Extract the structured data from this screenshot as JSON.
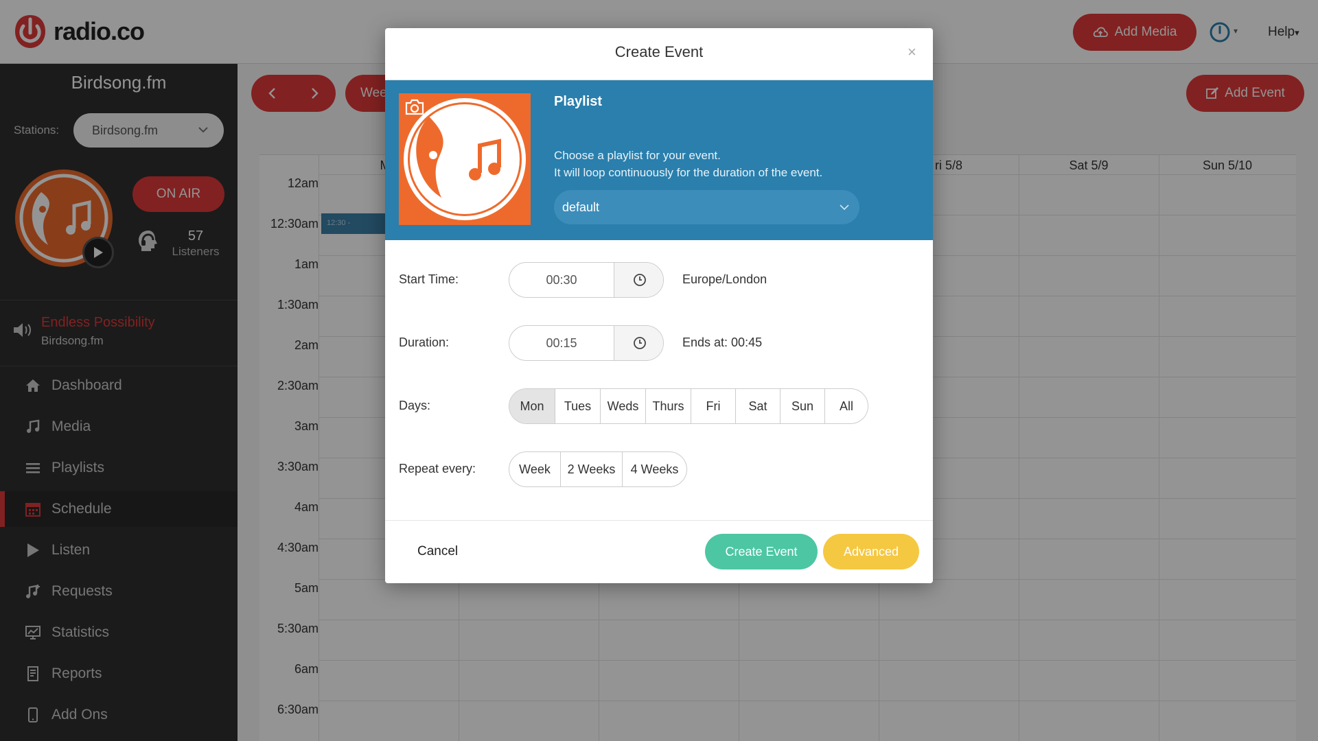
{
  "app": {
    "brand": "radio.co",
    "add_media_label": "Add Media",
    "help_label": "Help",
    "help_caret": "▾",
    "power_caret": "▾"
  },
  "sidebar": {
    "station_title": "Birdsong.fm",
    "stations_label": "Stations:",
    "stations_value": "Birdsong.fm",
    "on_air_label": "ON AIR",
    "listener_count": "57",
    "listener_label": "Listeners",
    "now_playing_title": "Endless Possibility",
    "now_playing_station": "Birdsong.fm",
    "items": [
      {
        "label": "Dashboard",
        "icon": "home-icon"
      },
      {
        "label": "Media",
        "icon": "music-note-icon"
      },
      {
        "label": "Playlists",
        "icon": "list-icon"
      },
      {
        "label": "Schedule",
        "icon": "calendar-icon",
        "active": true
      },
      {
        "label": "Listen",
        "icon": "play-icon"
      },
      {
        "label": "Requests",
        "icon": "request-icon"
      },
      {
        "label": "Statistics",
        "icon": "chart-icon"
      },
      {
        "label": "Reports",
        "icon": "report-icon"
      },
      {
        "label": "Add Ons",
        "icon": "mobile-icon"
      }
    ]
  },
  "calendar": {
    "week_label": "Wee",
    "add_event_label": "Add Event",
    "day_headers": [
      "Mo",
      "ri 5/8",
      "Sat 5/9",
      "Sun 5/10"
    ],
    "times": [
      "12am",
      "12:30am",
      "1am",
      "1:30am",
      "2am",
      "2:30am",
      "3am",
      "3:30am",
      "4am",
      "4:30am",
      "5am",
      "5:30am",
      "6am",
      "6:30am"
    ],
    "event_label": "12:30 -"
  },
  "modal": {
    "title": "Create Event",
    "close_label": "×",
    "playlist_title": "Playlist",
    "playlist_line1": "Choose a playlist for your event.",
    "playlist_line2": "It will loop continuously for the duration of the event.",
    "playlist_value": "default",
    "start_time_label": "Start Time:",
    "start_time_value": "00:30",
    "timezone": "Europe/London",
    "duration_label": "Duration:",
    "duration_value": "00:15",
    "ends_at": "Ends at: 00:45",
    "days_label": "Days:",
    "days": [
      "Mon",
      "Tues",
      "Weds",
      "Thurs",
      "Fri",
      "Sat",
      "Sun",
      "All"
    ],
    "selected_day": "Mon",
    "repeat_label": "Repeat every:",
    "repeat_options": [
      "Week",
      "2 Weeks",
      "4 Weeks"
    ],
    "cancel_label": "Cancel",
    "create_label": "Create Event",
    "advanced_label": "Advanced"
  },
  "colors": {
    "brand_red": "#e03a3a",
    "modal_band_blue": "#2a7fad",
    "create_green": "#4cc6a3",
    "advanced_yellow": "#f5c842",
    "art_orange": "#ee6a2c"
  }
}
